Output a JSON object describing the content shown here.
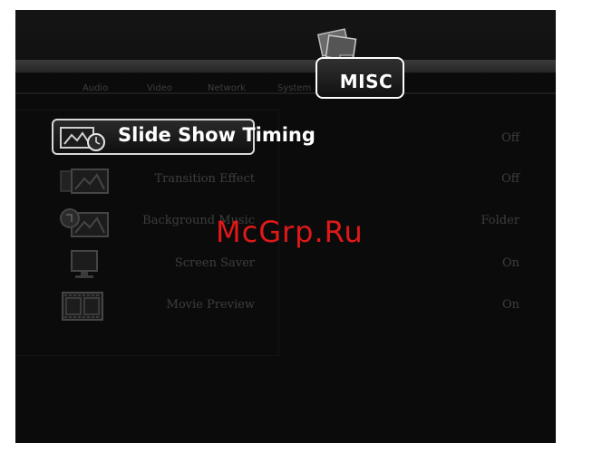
{
  "header": {
    "tabs": [
      "Audio",
      "Video",
      "Network",
      "System"
    ],
    "active_tab": "MISC"
  },
  "menu": {
    "items": [
      {
        "label": "Slide Show Timing",
        "value": "Off",
        "icon": "slideshow-timer-icon",
        "selected": true
      },
      {
        "label": "Transition Effect",
        "value": "Off",
        "icon": "transition-icon",
        "selected": false
      },
      {
        "label": "Background Music",
        "value": "Folder",
        "icon": "background-music-icon",
        "selected": false
      },
      {
        "label": "Screen Saver",
        "value": "On",
        "icon": "monitor-icon",
        "selected": false
      },
      {
        "label": "Movie Preview",
        "value": "On",
        "icon": "film-icon",
        "selected": false
      }
    ]
  },
  "watermark": "McGrp.Ru",
  "colors": {
    "background": "#0b0b0b",
    "dim_text": "#3e3e3e",
    "highlight_text": "#ffffff",
    "watermark": "#e01818"
  }
}
